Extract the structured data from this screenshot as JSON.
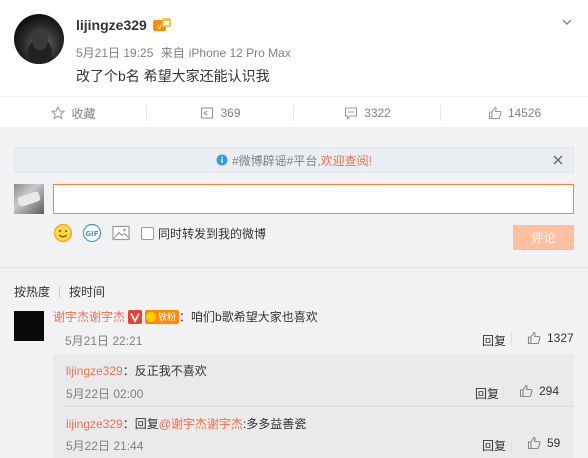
{
  "post": {
    "username": "lijingze329",
    "date": "5月21日 19:25",
    "source_prefix": "来自",
    "device": "iPhone 12 Pro Max",
    "text": "改了个b名 希望大家还能认识我"
  },
  "actions": {
    "favorite": "收藏",
    "repost": "369",
    "comment": "3322",
    "like": "14526"
  },
  "notice": {
    "prefix": "#微博辟谣#平台,",
    "link": "欢迎查阅!"
  },
  "composer": {
    "input_value": "",
    "repost_label": "同时转发到我的微博",
    "submit_label": "评论"
  },
  "sort": {
    "by_hot": "按热度",
    "by_time": "按时间"
  },
  "comments": [
    {
      "user": "谢宇杰谢宇杰",
      "fan_badge": "铁粉",
      "text": "：咱们b歌希望大家也喜欢",
      "time": "5月21日 22:21",
      "reply": "回复",
      "likes": "1327"
    }
  ],
  "replies": [
    {
      "user": "lijingze329",
      "text": "：反正我不喜欢",
      "time": "5月22日 02:00",
      "reply": "回复",
      "likes": "294"
    },
    {
      "user": "lijingze329",
      "text_prefix": "：回复",
      "mention": "@谢宇杰谢宇杰",
      "text_suffix": ":多多益善瓷",
      "time": "5月22日 21:44",
      "reply": "回复",
      "likes": "59"
    }
  ],
  "colors": {
    "accent": "#eb7350",
    "submit_bg": "#ffc09f",
    "input_border": "#ff8140",
    "comment_bg": "#f2f2f5"
  }
}
